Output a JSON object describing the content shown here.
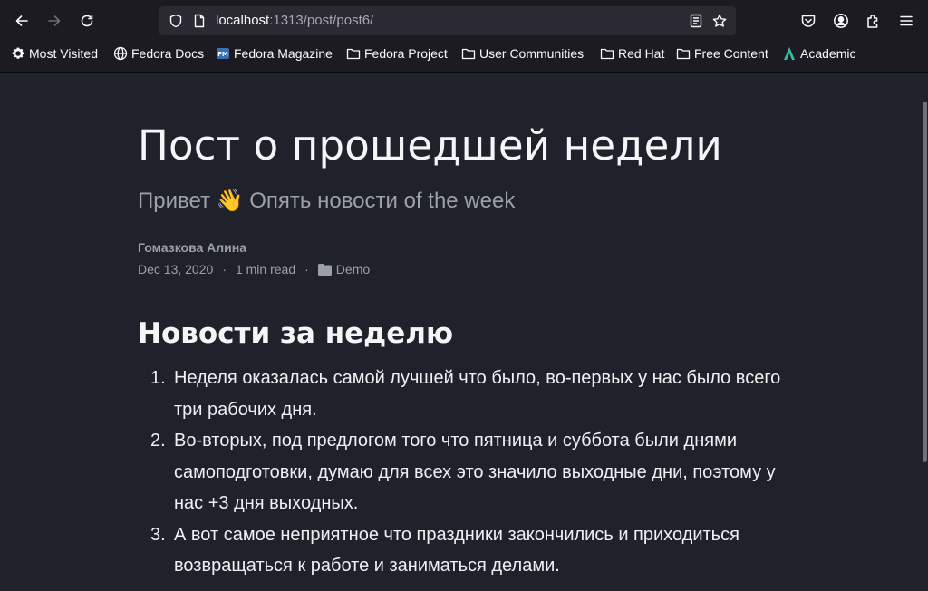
{
  "browser": {
    "url_host": "localhost",
    "url_path": ":1313/post/post6/",
    "bookmarks": [
      {
        "label": "Most Visited",
        "icon": "gear-icon"
      },
      {
        "label": "Fedora Docs",
        "icon": "globe-icon"
      },
      {
        "label": "Fedora Magazine",
        "icon": "fedora-magazine-icon"
      },
      {
        "label": "Fedora Project",
        "icon": "folder-icon"
      },
      {
        "label": "User Communities",
        "icon": "folder-icon"
      },
      {
        "label": "Red Hat",
        "icon": "folder-icon"
      },
      {
        "label": "Free Content",
        "icon": "folder-icon"
      },
      {
        "label": "Academic",
        "icon": "academic-icon"
      }
    ]
  },
  "post": {
    "title": "Пост о прошедшей недели",
    "subtitle_before": "Привет",
    "subtitle_emoji": "👋",
    "subtitle_after": "Опять новости of the week",
    "author": "Гомазкова Алина",
    "date": "Dec 13, 2020",
    "read_time": "1 min read",
    "separator": "·",
    "category": "Demo"
  },
  "content": {
    "heading": "Новости за неделю",
    "items": [
      {
        "num": "1.",
        "text": "Неделя оказалась самой лучшей что было, во-первых у нас было всего три рабочих дня."
      },
      {
        "num": "2.",
        "text": "Во-вторых, под предлогом того что пятница и суббота были днями самоподготовки, думаю для всех это значило выходные дни, поэтому у нас +3 дня выходных."
      },
      {
        "num": "3.",
        "text": "А вот самое неприятное что праздники закончились и приходиться возвращаться к работе и заниматься делами."
      }
    ]
  },
  "colors": {
    "page_bg": "#1f222b",
    "chrome_bg": "#1c1b22",
    "text_primary": "#f5f5f7",
    "text_muted": "#9ca0a8"
  }
}
